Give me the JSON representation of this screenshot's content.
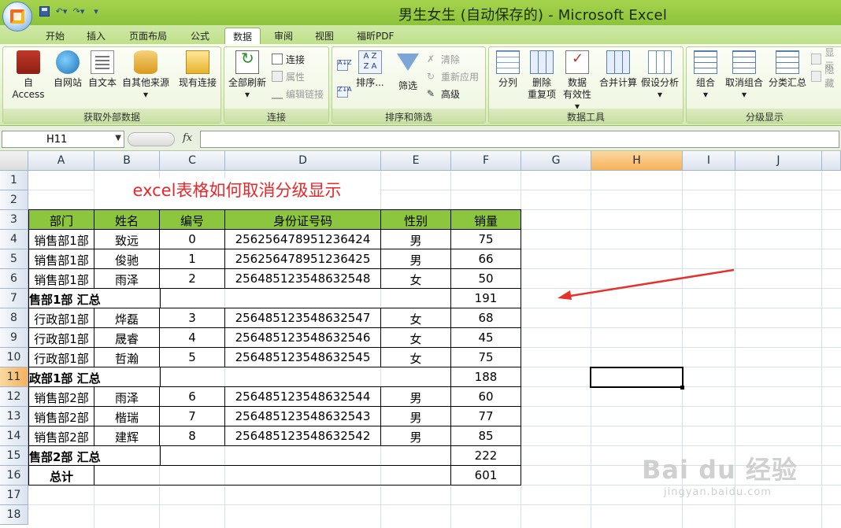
{
  "window": {
    "title": "男生女生 (自动保存的) - Microsoft Excel"
  },
  "tabs": [
    "开始",
    "插入",
    "页面布局",
    "公式",
    "数据",
    "审阅",
    "视图",
    "福昕PDF"
  ],
  "active_tab": "数据",
  "ribbon": {
    "get_external": {
      "label": "获取外部数据",
      "buttons": [
        "自 Access",
        "自网站",
        "自文本",
        "自其他来源",
        "现有连接"
      ]
    },
    "connections": {
      "label": "连接",
      "refresh_all": "全部刷新",
      "connections": "连接",
      "properties": "属性",
      "edit_links": "编辑链接"
    },
    "sort_filter": {
      "label": "排序和筛选",
      "sort": "排序...",
      "filter": "筛选",
      "clear": "清除",
      "reapply": "重新应用",
      "advanced": "高级"
    },
    "data_tools": {
      "label": "数据工具",
      "split": "分列",
      "remove_dup_1": "删除",
      "remove_dup_2": "重复项",
      "validation_1": "数据",
      "validation_2": "有效性",
      "consolidate": "合并计算",
      "whatif": "假设分析"
    },
    "outline": {
      "label": "分级显示",
      "group": "组合",
      "ungroup": "取消组合",
      "subtotal": "分类汇总",
      "show": "显示",
      "hide": "隐藏"
    }
  },
  "formula_bar": {
    "name_box": "H11",
    "fx": "fx",
    "value": ""
  },
  "columns": [
    "A",
    "B",
    "C",
    "D",
    "E",
    "F",
    "G",
    "H",
    "I",
    "J"
  ],
  "selected_column": "H",
  "selected_row": "11",
  "rows": [
    "1",
    "2",
    "3",
    "4",
    "5",
    "6",
    "7",
    "8",
    "9",
    "10",
    "11",
    "12",
    "13",
    "14",
    "15",
    "16",
    "17",
    "18"
  ],
  "sheet": {
    "title": "excel表格如何取消分级显示",
    "headers": [
      "部门",
      "姓名",
      "编号",
      "身份证号码",
      "性别",
      "销量"
    ],
    "r4": [
      "销售部1部",
      "致远",
      "0",
      "256256478951236424",
      "男",
      "75"
    ],
    "r5": [
      "销售部1部",
      "俊驰",
      "1",
      "256256478951236425",
      "男",
      "66"
    ],
    "r6": [
      "销售部1部",
      "雨泽",
      "2",
      "256485123548632548",
      "女",
      "50"
    ],
    "r7": [
      "售部1部 汇总",
      "191"
    ],
    "r8": [
      "行政部1部",
      "烨磊",
      "3",
      "256485123548632547",
      "女",
      "68"
    ],
    "r9": [
      "行政部1部",
      "晟睿",
      "4",
      "256485123548632546",
      "女",
      "45"
    ],
    "r10": [
      "行政部1部",
      "哲瀚",
      "5",
      "256485123548632545",
      "女",
      "75"
    ],
    "r11": [
      "政部1部 汇总",
      "188"
    ],
    "r12": [
      "销售部2部",
      "雨泽",
      "6",
      "256485123548632544",
      "男",
      "60"
    ],
    "r13": [
      "销售部2部",
      "楷瑞",
      "7",
      "256485123548632543",
      "男",
      "77"
    ],
    "r14": [
      "销售部2部",
      "建辉",
      "8",
      "256485123548632542",
      "男",
      "85"
    ],
    "r15": [
      "售部2部 汇总",
      "222"
    ],
    "r16": [
      "总计",
      "601"
    ]
  },
  "watermark": {
    "main": "Bai du 经验",
    "url": "jingyan.baidu.com"
  },
  "colors": {
    "header_fill": "#8cc63f",
    "title_red": "#e8272a",
    "arrow_red": "#e5322d"
  }
}
